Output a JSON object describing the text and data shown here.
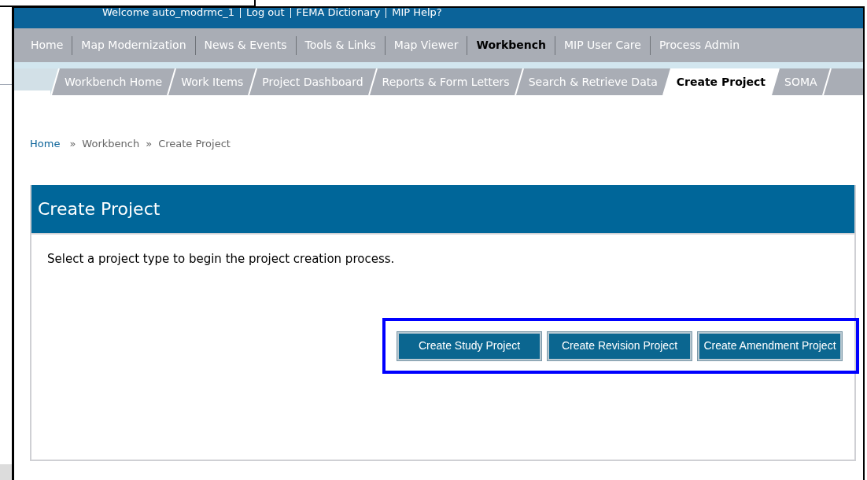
{
  "top_links": [
    "Welcome auto_modrmc_1",
    "Log out",
    "FEMA Dictionary",
    "MIP Help?"
  ],
  "nav": [
    {
      "label": "Home",
      "selected": false
    },
    {
      "label": "Map Modernization",
      "selected": false
    },
    {
      "label": "News & Events",
      "selected": false
    },
    {
      "label": "Tools & Links",
      "selected": false
    },
    {
      "label": "Map Viewer",
      "selected": false
    },
    {
      "label": "Workbench",
      "selected": true
    },
    {
      "label": "MIP User Care",
      "selected": false
    },
    {
      "label": "Process Admin",
      "selected": false
    }
  ],
  "subtabs": [
    {
      "label": "Workbench Home",
      "selected": false
    },
    {
      "label": "Work Items",
      "selected": false
    },
    {
      "label": "Project Dashboard",
      "selected": false
    },
    {
      "label": "Reports & Form Letters",
      "selected": false
    },
    {
      "label": "Search & Retrieve Data",
      "selected": false
    },
    {
      "label": "Create Project",
      "selected": true
    },
    {
      "label": "SOMA",
      "selected": false
    }
  ],
  "breadcrumb": [
    {
      "kind": "link",
      "text": "Home"
    },
    {
      "kind": "separator",
      "text": "»"
    },
    {
      "kind": "text",
      "text": "Workbench"
    },
    {
      "kind": "separator",
      "text": "»"
    },
    {
      "kind": "text",
      "text": "Create Project"
    }
  ],
  "panel": {
    "title": "Create Project",
    "instruction": "Select a project type to begin the project creation process.",
    "buttons": [
      "Create Study Project",
      "Create Revision Project",
      "Create Amendment Project"
    ]
  }
}
